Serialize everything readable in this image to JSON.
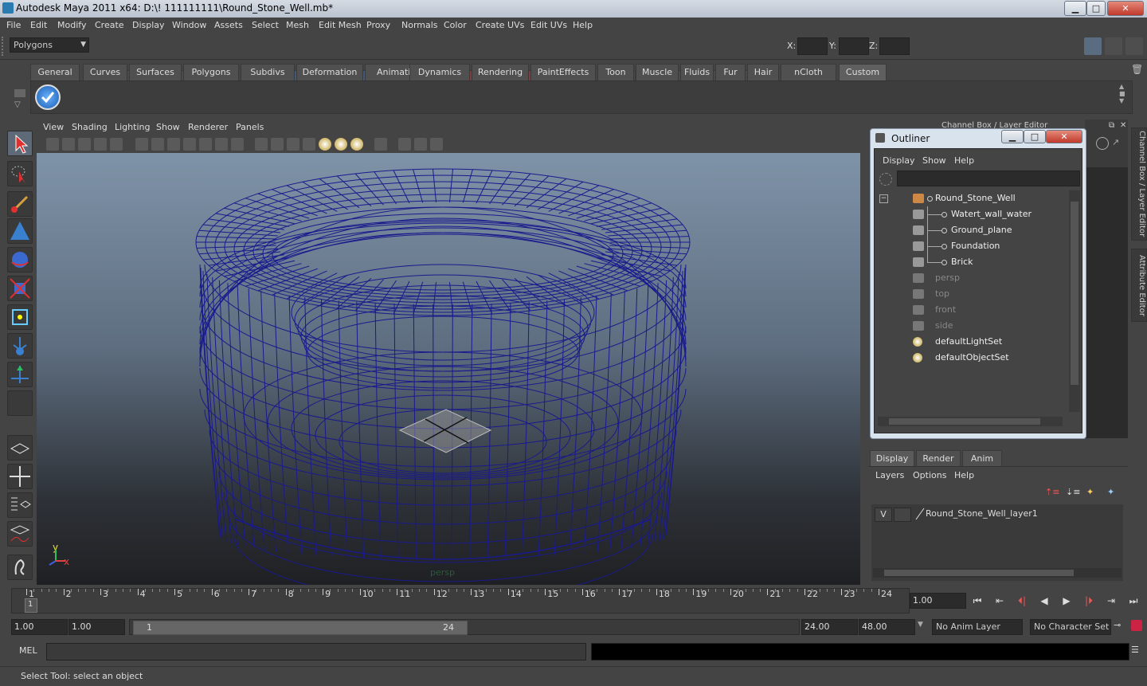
{
  "window": {
    "title": "Autodesk Maya 2011 x64: D:\\! 111111111\\Round_Stone_Well.mb*",
    "minimize": "▁",
    "maximize": "□",
    "close": "✕"
  },
  "menubar": [
    "File",
    "Edit",
    "Modify",
    "Create",
    "Display",
    "Window",
    "Assets",
    "Select",
    "Mesh",
    "Edit Mesh",
    "Proxy",
    "Normals",
    "Color",
    "Create UVs",
    "Edit UVs",
    "Help"
  ],
  "statusline": {
    "menuset": "Polygons",
    "x_label": "X:",
    "y_label": "Y:",
    "z_label": "Z:"
  },
  "shelf": {
    "tabs": [
      "General",
      "Curves",
      "Surfaces",
      "Polygons",
      "Subdivs",
      "Deformation",
      "Animation",
      "Dynamics",
      "Rendering",
      "PaintEffects",
      "Toon",
      "Muscle",
      "Fluids",
      "Fur",
      "Hair",
      "nCloth",
      "Custom"
    ],
    "active_tab": "Custom"
  },
  "viewport": {
    "menu": [
      "View",
      "Shading",
      "Lighting",
      "Show",
      "Renderer",
      "Panels"
    ],
    "camera_label": "persp",
    "axis_y": "y",
    "axis_x": "x"
  },
  "outliner": {
    "title": "Outliner",
    "menu": [
      "Display",
      "Show",
      "Help"
    ],
    "items": [
      {
        "label": "Round_Stone_Well",
        "type": "group",
        "dim": false
      },
      {
        "label": "Watert_wall_water",
        "type": "mesh",
        "dim": false
      },
      {
        "label": "Ground_plane",
        "type": "mesh",
        "dim": false
      },
      {
        "label": "Foundation",
        "type": "mesh",
        "dim": false
      },
      {
        "label": "Brick",
        "type": "mesh",
        "dim": false
      },
      {
        "label": "persp",
        "type": "camera",
        "dim": true
      },
      {
        "label": "top",
        "type": "camera",
        "dim": true
      },
      {
        "label": "front",
        "type": "camera",
        "dim": true
      },
      {
        "label": "side",
        "type": "camera",
        "dim": true
      },
      {
        "label": "defaultLightSet",
        "type": "set",
        "dim": false
      },
      {
        "label": "defaultObjectSet",
        "type": "set",
        "dim": false
      }
    ]
  },
  "channelbox": {
    "header": "Channel Box / Layer Editor",
    "side_tab_1": "Channel Box / Layer Editor",
    "side_tab_2": "Attribute Editor"
  },
  "layer_editor": {
    "tabs": [
      "Display",
      "Render",
      "Anim"
    ],
    "active_tab": "Display",
    "menu": [
      "Layers",
      "Options",
      "Help"
    ],
    "layer_visible": "V",
    "layer_name": "Round_Stone_Well_layer1"
  },
  "timeline": {
    "ticks": [
      "1",
      "2",
      "3",
      "4",
      "5",
      "6",
      "7",
      "8",
      "9",
      "10",
      "11",
      "12",
      "13",
      "14",
      "15",
      "16",
      "17",
      "18",
      "19",
      "20",
      "21",
      "22",
      "23",
      "24"
    ],
    "current_frame_marker": "1",
    "current_time": "1.00"
  },
  "range": {
    "start_time": "1.00",
    "playback_start": "1.00",
    "range_start_label": "1",
    "range_end_label": "24",
    "playback_end": "24.00",
    "end_time": "48.00",
    "anim_layer": "No Anim Layer",
    "character_set": "No Character Set"
  },
  "command": {
    "label": "MEL"
  },
  "helpline": {
    "text": "Select Tool: select an object"
  },
  "colors": {
    "wireframe": "#1a1a8c",
    "ui_bg": "#444444",
    "active_tab": "#5f5f5f"
  }
}
